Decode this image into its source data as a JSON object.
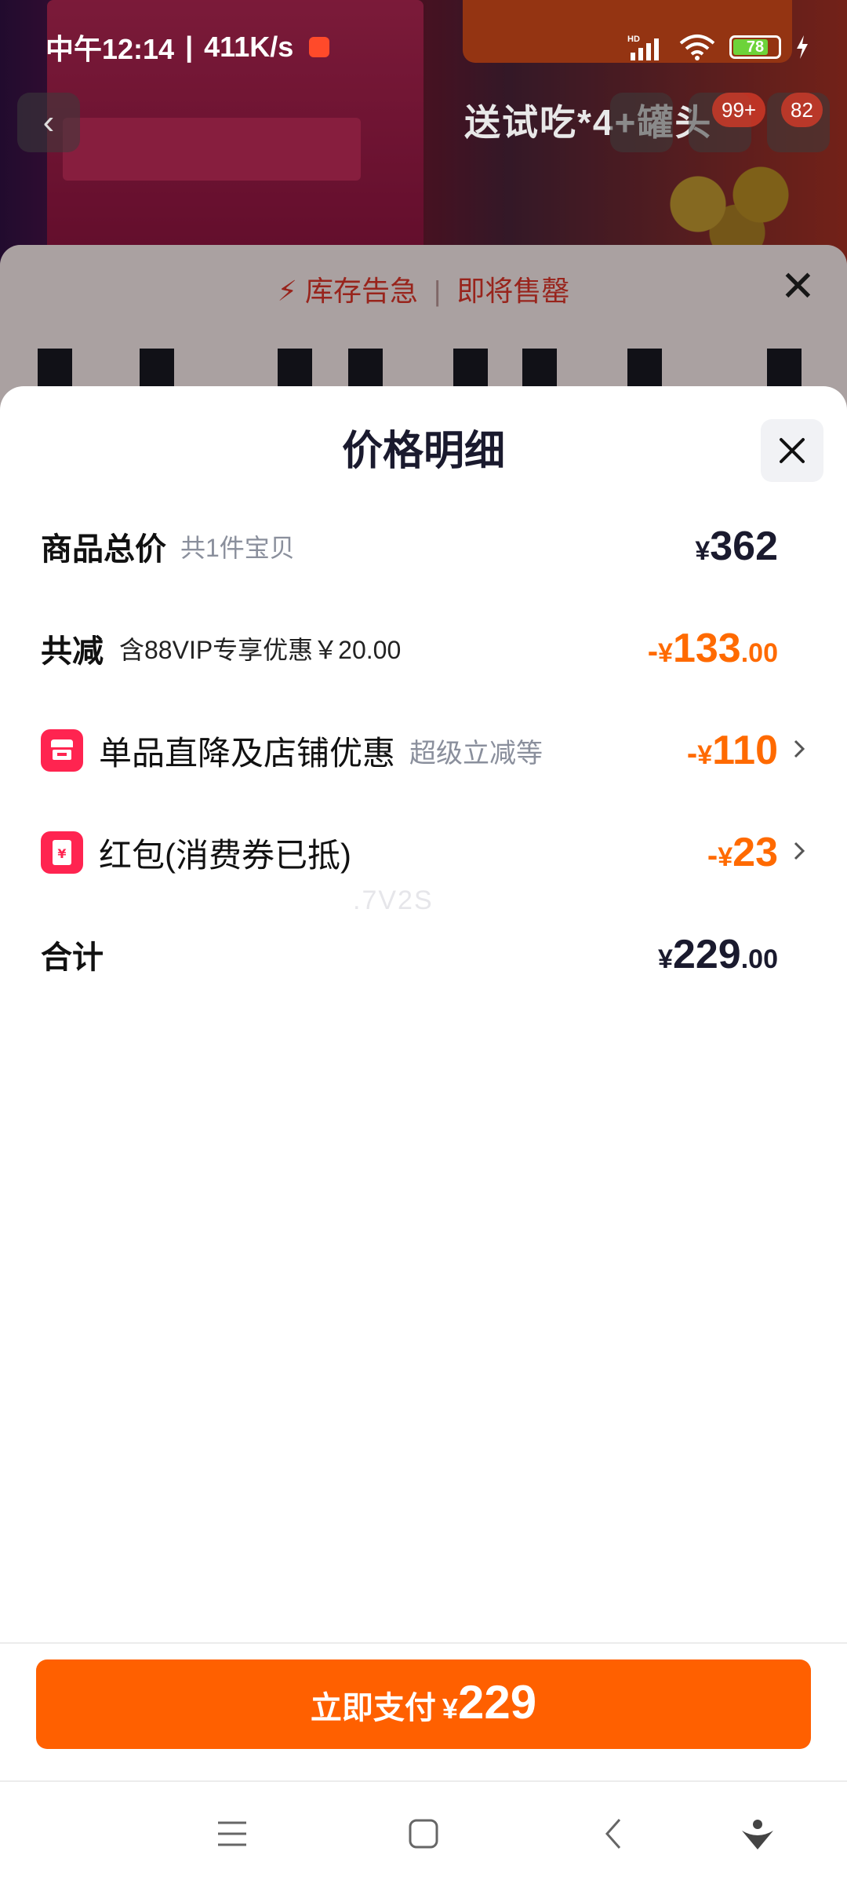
{
  "status_bar": {
    "time": "中午12:14",
    "speed": "411K/s",
    "battery": "78"
  },
  "background_page": {
    "promo_text": "送试吃*4+罐头",
    "cart_badge": "99+",
    "message_badge": "82"
  },
  "stock_sheet": {
    "stock_warning": "库存告急",
    "sell_out_soon": "即将售罄"
  },
  "price_detail": {
    "title": "价格明细",
    "total": {
      "label": "商品总价",
      "count_note": "共1件宝贝",
      "symbol": "¥",
      "value": "362"
    },
    "reduction": {
      "label": "共减",
      "note": "含88VIP专享优惠￥20.00",
      "prefix": "-",
      "symbol": "¥",
      "integer": "133",
      "decimal": ".00"
    },
    "items": [
      {
        "icon": "shop-icon",
        "label": "单品直降及店铺优惠",
        "note": "超级立减等",
        "prefix": "-",
        "symbol": "¥",
        "value": "110"
      },
      {
        "icon": "red-packet-icon",
        "label": "红包(消费券已抵)",
        "note": "",
        "prefix": "-",
        "symbol": "¥",
        "value": "23"
      }
    ],
    "sum": {
      "label": "合计",
      "symbol": "¥",
      "integer": "229",
      "decimal": ".00"
    },
    "watermark": ".7V2S"
  },
  "pay_bar": {
    "label": "立即支付",
    "symbol": "¥",
    "amount": "229"
  },
  "colors": {
    "accent_orange": "#ff6000",
    "discount_orange": "#ff6a00",
    "icon_red": "#ff2450",
    "stock_red": "#e0352a"
  }
}
